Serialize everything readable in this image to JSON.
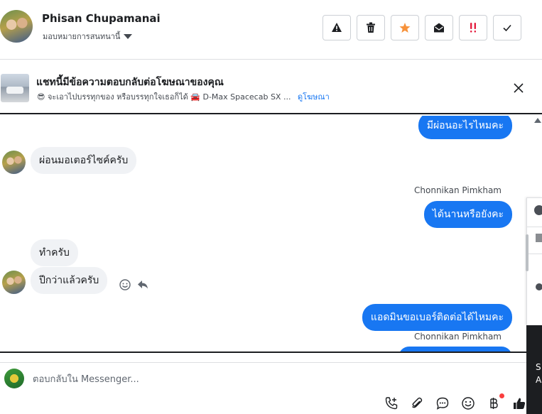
{
  "header": {
    "contact_name": "Phisan Chupamanai",
    "assign_label": "มอบหมายการสนทนานี้",
    "buttons": [
      {
        "name": "spam",
        "icon": "warning-icon"
      },
      {
        "name": "delete",
        "icon": "trash-icon"
      },
      {
        "name": "star",
        "icon": "star-icon",
        "color": "#f7923b"
      },
      {
        "name": "mark-unread",
        "icon": "envelope-open-icon"
      },
      {
        "name": "important",
        "icon": "double-exclamation-icon",
        "color": "#e41e3f"
      },
      {
        "name": "done",
        "icon": "check-icon"
      }
    ]
  },
  "ad": {
    "title": "แชทนี้มีข้อความตอบกลับต่อโฆษณาของคุณ",
    "emoji": "😎",
    "subtitle": "จะเอาไปบรรทุกของ หรือบรรทุกใจเธอก็ได้ 🚘 D-Max Spacecab SX ...",
    "link": "ดูโฆษณา"
  },
  "messages": {
    "m1": "มีผ่อนอะไรไหมคะ",
    "m2": "ผ่อนมอเตอร์ไซค์ครับ",
    "sender1": "Chonnikan Pimkham",
    "m3": "ได้นานหรือยังคะ",
    "m4": "ทำครับ",
    "m5": "ปีกว่าแล้วครับ",
    "m6": "แอดมินขอเบอร์ติดต่อได้ไหมคะ",
    "sender2": "Chonnikan Pimkham"
  },
  "composer": {
    "placeholder": "ตอบกลับใน Messenger..."
  },
  "side": {
    "dark_text1": "S",
    "dark_text2": "A"
  },
  "colors": {
    "accent": "#1877f2",
    "incoming_bubble": "#f0f2f5",
    "star": "#f7923b",
    "important": "#e41e3f"
  }
}
